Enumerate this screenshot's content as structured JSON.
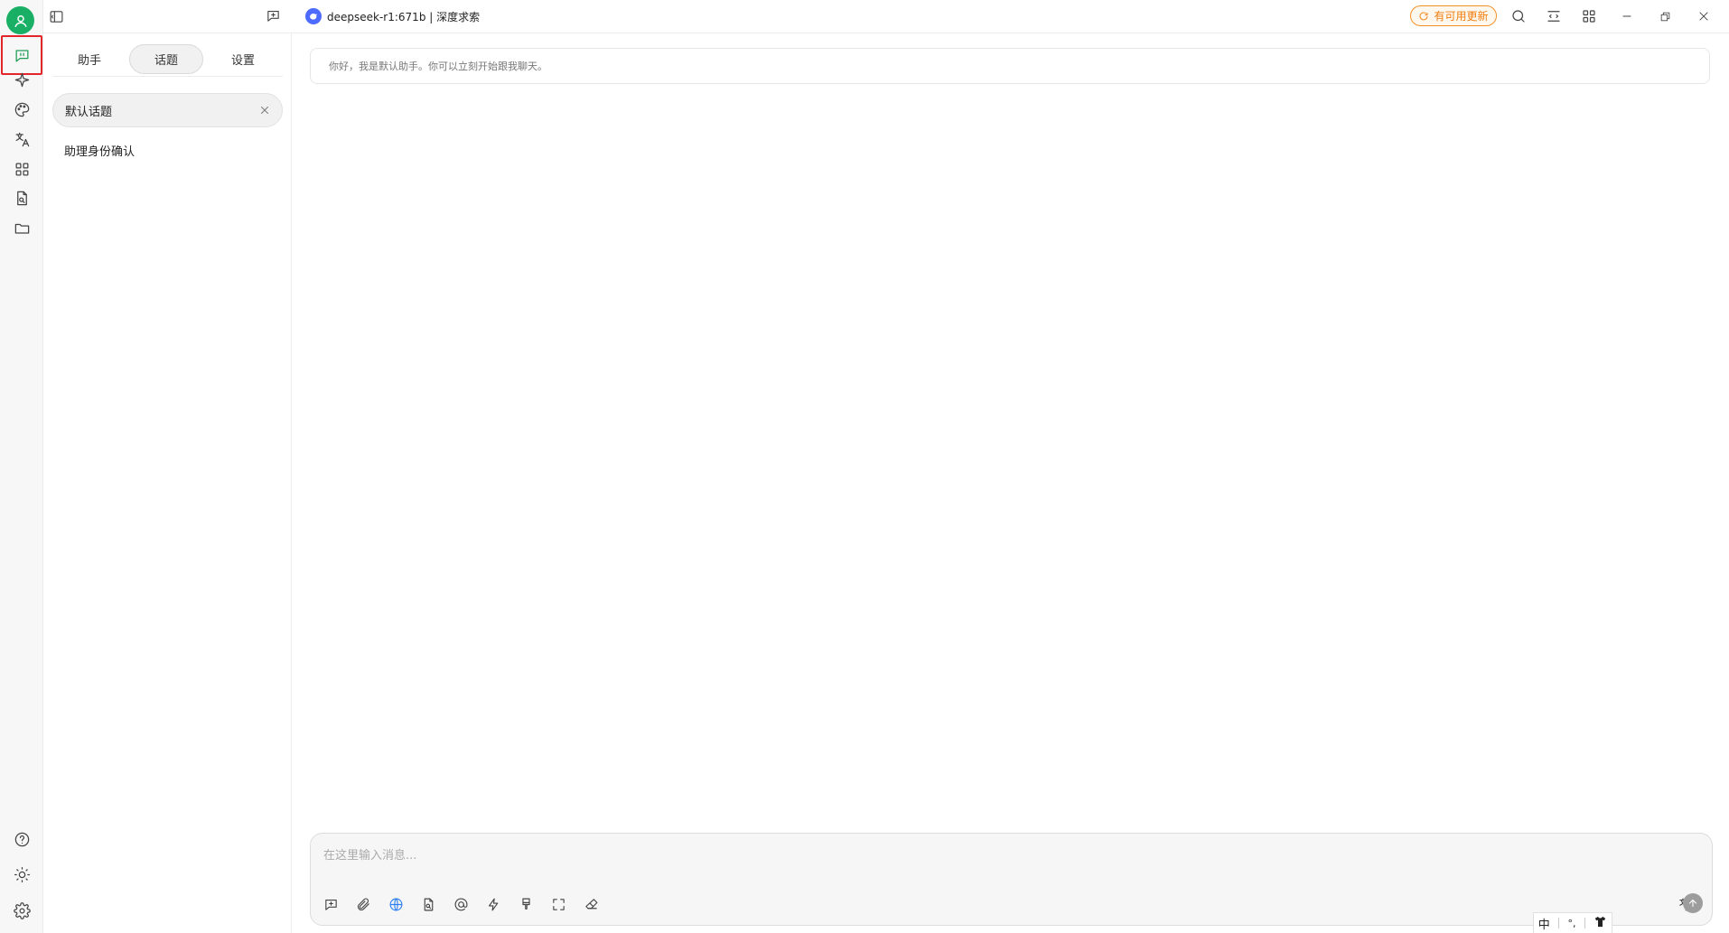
{
  "topbar": {
    "model_name": "deepseek-r1:671b | 深度求索",
    "update_label": "有可用更新"
  },
  "panel": {
    "tabs": [
      {
        "label": "助手"
      },
      {
        "label": "话题",
        "active": true
      },
      {
        "label": "设置"
      }
    ],
    "topics": [
      {
        "label": "默认话题",
        "active": true
      },
      {
        "label": "助理身份确认"
      }
    ]
  },
  "main": {
    "system_message": "你好，我是默认助手。你可以立刻开始跟我聊天。"
  },
  "composer": {
    "placeholder": "在这里输入消息..."
  },
  "ime": {
    "lang": "中",
    "punct": "°,",
    "skin_icon": "shirt-icon"
  },
  "colors": {
    "accent_green": "#19b065",
    "update_orange": "#f07c0c",
    "highlight_red": "#e2262b",
    "globe_blue": "#2f7ff0"
  }
}
